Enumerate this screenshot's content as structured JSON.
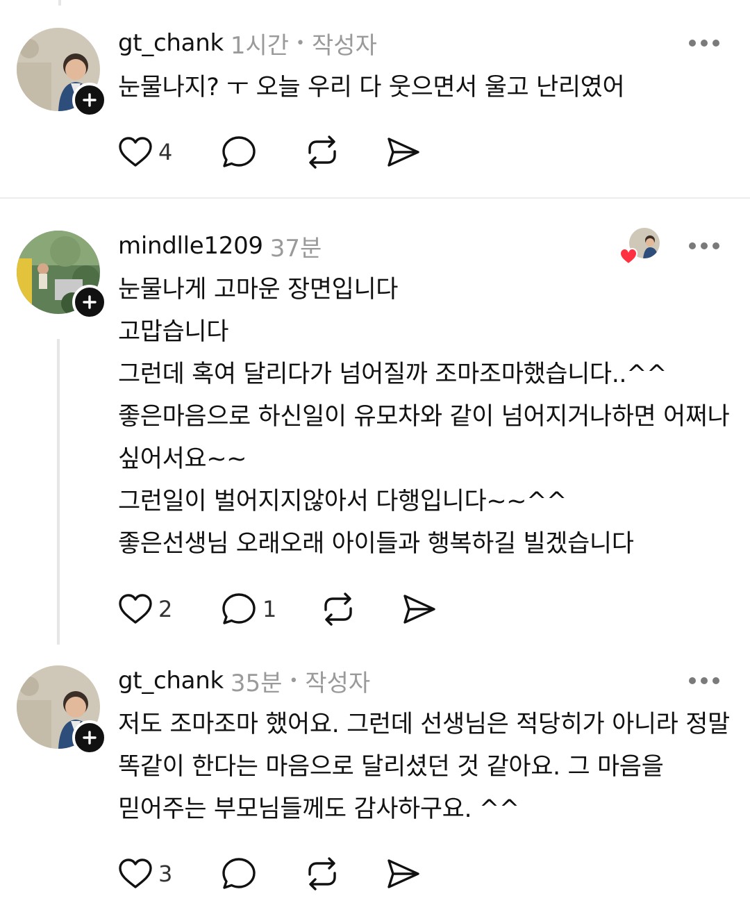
{
  "comments": [
    {
      "username": "gt_chank",
      "time": "1시간",
      "author_badge": "작성자",
      "lines": [
        "눈물나지? ㅜ  오늘 우리 다 웃으면서 울고 난리였어"
      ],
      "likes": "4",
      "replies": ""
    },
    {
      "username": "mindlle1209",
      "time": "37분",
      "author_badge": "",
      "lines": [
        "눈물나게 고마운 장면입니다",
        "고맙습니다",
        "그런데 혹여 달리다가 넘어질까 조마조마했습니다..^^",
        "좋은마음으로 하신일이 유모차와 같이 넘어지거나하면 어쩌나",
        "싶어서요~~",
        "그런일이 벌어지지않아서 다행입니다~~^^",
        "좋은선생님 오래오래 아이들과 행복하길 빌겠습니다"
      ],
      "likes": "2",
      "replies": "1",
      "liked_by_author": true
    },
    {
      "username": "gt_chank",
      "time": "35분",
      "author_badge": "작성자",
      "lines": [
        "저도 조마조마 했어요. 그런데 선생님은 적당히가 아니라 정말",
        "똑같이 한다는 마음으로 달리셨던 것 같아요. 그 마음을",
        "믿어주는 부모님들께도 감사하구요. ^^"
      ],
      "likes": "3",
      "replies": ""
    }
  ],
  "separator": "•",
  "icons": [
    "heart-icon",
    "comment-icon",
    "repost-icon",
    "share-icon",
    "more-icon",
    "plus-icon"
  ],
  "colors": {
    "text": "#111111",
    "meta": "#9a9a9a",
    "like_badge": "#ff3040"
  }
}
